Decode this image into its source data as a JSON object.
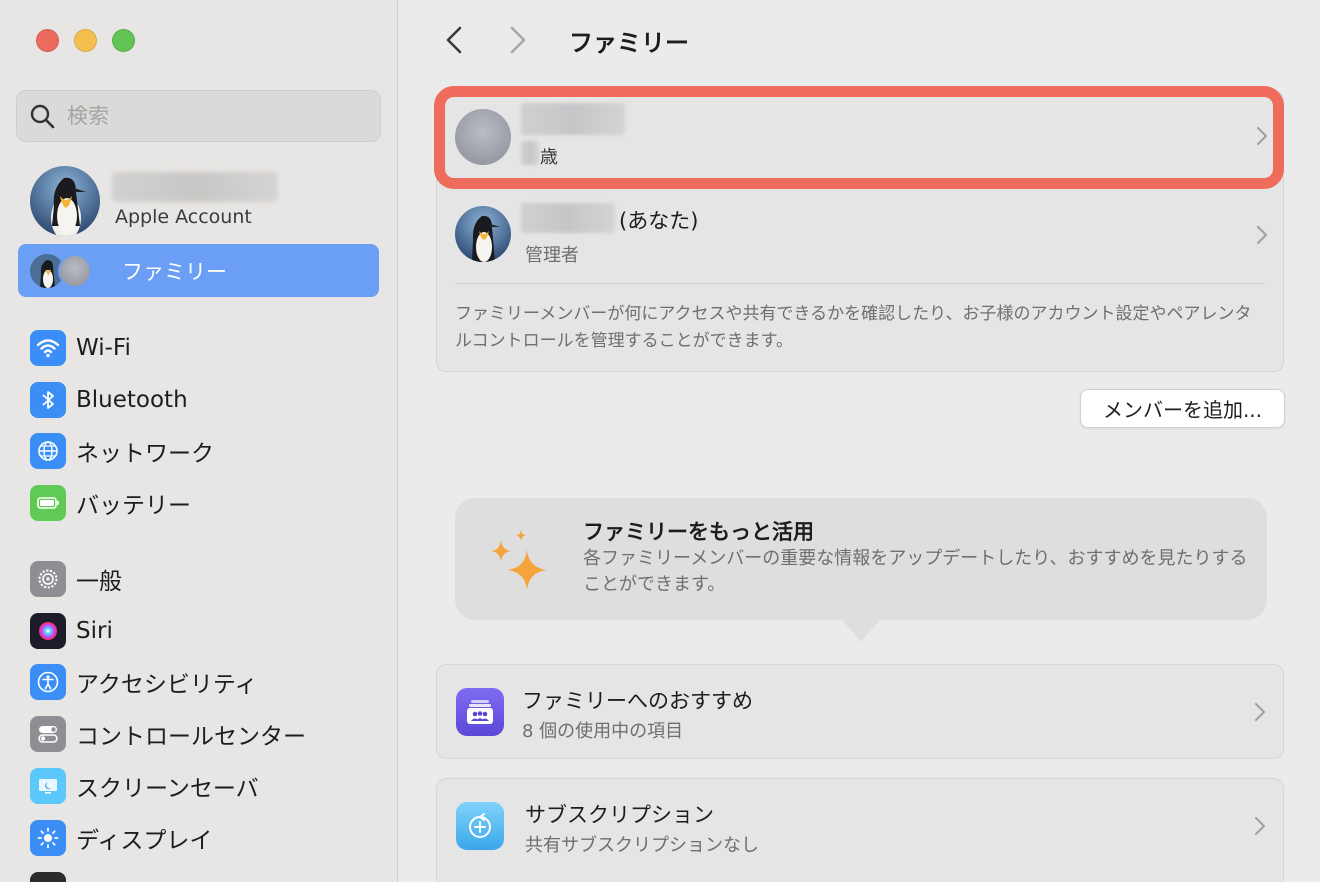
{
  "window": {
    "title": "ファミリー",
    "buttons": [
      "close",
      "minimize",
      "zoom"
    ]
  },
  "sidebar": {
    "search_placeholder": "検索",
    "account": {
      "name": "",
      "subtitle": "Apple Account"
    },
    "selected_item": {
      "label": "ファミリー"
    },
    "items": [
      {
        "label": "Wi-Fi",
        "icon": "wifi-icon",
        "color": "#3a8ef6"
      },
      {
        "label": "Bluetooth",
        "icon": "bluetooth-icon",
        "color": "#3a8ef6"
      },
      {
        "label": "ネットワーク",
        "icon": "globe-icon",
        "color": "#3a8ef6"
      },
      {
        "label": "バッテリー",
        "icon": "battery-icon",
        "color": "#5fcb55"
      },
      {
        "label": "一般",
        "icon": "gear-icon",
        "color": "#8e8e93"
      },
      {
        "label": "Siri",
        "icon": "siri-icon",
        "color": "#2b2b3a"
      },
      {
        "label": "アクセシビリティ",
        "icon": "accessibility-icon",
        "color": "#3a8ef6"
      },
      {
        "label": "コントロールセンター",
        "icon": "control-center-icon",
        "color": "#8e8e93"
      },
      {
        "label": "スクリーンセーバ",
        "icon": "screensaver-icon",
        "color": "#5ac8fa"
      },
      {
        "label": "ディスプレイ",
        "icon": "display-icon",
        "color": "#3a8ef6"
      }
    ]
  },
  "main": {
    "title": "ファミリー",
    "members": [
      {
        "name": "",
        "role": "歳",
        "highlighted": true
      },
      {
        "name": "",
        "name_suffix": "(あなた)",
        "role": "管理者"
      }
    ],
    "description": "ファミリーメンバーが何にアクセスや共有できるかを確認したり、お子様のアカウント設定やペアレンタルコントロールを管理することができます。",
    "add_member_button": "メンバーを追加...",
    "tip": {
      "title": "ファミリーをもっと活用",
      "text": "各ファミリーメンバーの重要な情報をアップデートしたり、おすすめを見たりすることができます。"
    },
    "rows": [
      {
        "title": "ファミリーへのおすすめ",
        "subtitle": "8 個の使用中の項目",
        "icon": "family-checklist-icon"
      },
      {
        "title": "サブスクリプション",
        "subtitle": "共有サブスクリプションなし",
        "icon": "subscriptions-icon"
      }
    ]
  },
  "colors": {
    "accent": "#6b9ef5",
    "highlight": "#ef6b5c",
    "sparkle": "#f4a43a"
  }
}
